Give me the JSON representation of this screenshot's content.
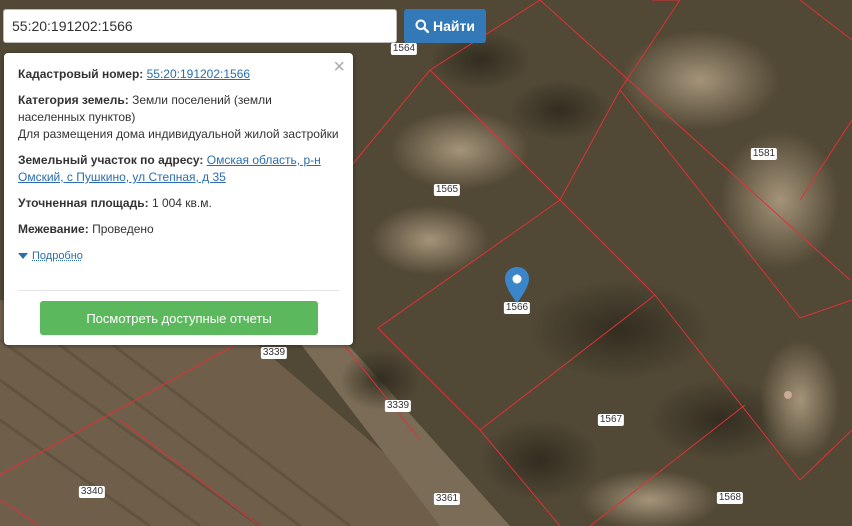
{
  "search": {
    "value": "55:20:191202:1566",
    "button_label": "Найти",
    "icon": "search-icon"
  },
  "popup": {
    "cadastral_label": "Кадастровый номер:",
    "cadastral_value": "55:20:191202:1566",
    "category_label": "Категория земель:",
    "category_value": "Земли поселений (земли населенных пунктов)",
    "purpose": "Для размещения дома индивидуальной жилой застройки",
    "address_label": "Земельный участок по адресу:",
    "address_value": "Омская область, р-н Омский, с Пушкино, ул Степная, д 35",
    "area_label": "Уточненная площадь:",
    "area_value": "1 004 кв.м.",
    "survey_label": "Межевание:",
    "survey_value": "Проведено",
    "more_label": "Подробно",
    "report_button": "Посмотреть доступные отчеты",
    "close_symbol": "×"
  },
  "parcels": [
    {
      "id": "1564"
    },
    {
      "id": "1565"
    },
    {
      "id": "1566"
    },
    {
      "id": "1567"
    },
    {
      "id": "1568"
    },
    {
      "id": "1581"
    },
    {
      "id": "3339"
    },
    {
      "id": "3339"
    },
    {
      "id": "3340"
    },
    {
      "id": "3361"
    }
  ],
  "colors": {
    "boundary": "#e0303a",
    "button_primary": "#3379b7",
    "button_success": "#5cb85c",
    "link": "#2a6db0",
    "marker": "#3a86c8"
  }
}
